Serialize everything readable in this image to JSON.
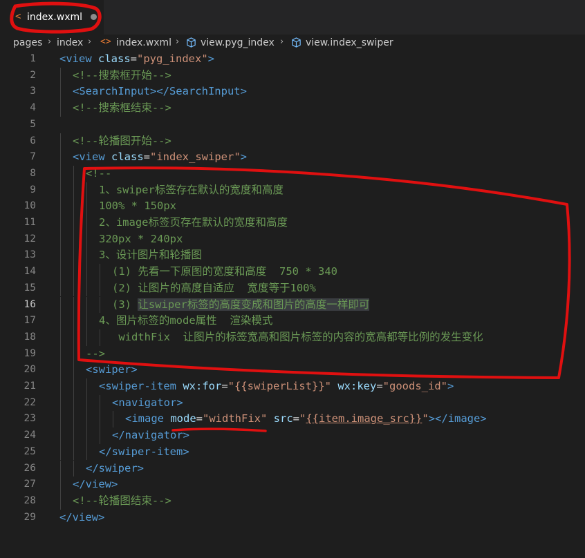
{
  "tab": {
    "icon": "xml-file-icon",
    "label": "index.wxml"
  },
  "breadcrumb": {
    "items": [
      "pages",
      "index",
      "index.wxml",
      "view.pyg_index",
      "view.index_swiper"
    ]
  },
  "editor": {
    "active_line": 16,
    "lines": [
      {
        "n": "1",
        "indent": 0,
        "tokens": [
          [
            "t",
            "<view "
          ],
          [
            "a",
            "class"
          ],
          [
            "w",
            "="
          ],
          [
            "s",
            "\"pyg_index\""
          ],
          [
            "t",
            ">"
          ]
        ]
      },
      {
        "n": "2",
        "indent": 1,
        "tokens": [
          [
            "c",
            "<!--搜索框开始-->"
          ]
        ]
      },
      {
        "n": "3",
        "indent": 1,
        "tokens": [
          [
            "t",
            "<SearchInput></SearchInput>"
          ]
        ]
      },
      {
        "n": "4",
        "indent": 1,
        "tokens": [
          [
            "c",
            "<!--搜索框结束-->"
          ]
        ]
      },
      {
        "n": "5",
        "indent": 0,
        "tokens": []
      },
      {
        "n": "6",
        "indent": 1,
        "tokens": [
          [
            "c",
            "<!--轮播图开始-->"
          ]
        ]
      },
      {
        "n": "7",
        "indent": 1,
        "tokens": [
          [
            "t",
            "<view "
          ],
          [
            "a",
            "class"
          ],
          [
            "w",
            "="
          ],
          [
            "s",
            "\"index_swiper\""
          ],
          [
            "t",
            ">"
          ]
        ]
      },
      {
        "n": "8",
        "indent": 2,
        "tokens": [
          [
            "c",
            "<!--"
          ]
        ]
      },
      {
        "n": "9",
        "indent": 3,
        "tokens": [
          [
            "c",
            "1、swiper标签存在默认的宽度和高度"
          ]
        ]
      },
      {
        "n": "10",
        "indent": 3,
        "tokens": [
          [
            "c",
            "100% * 150px"
          ]
        ]
      },
      {
        "n": "11",
        "indent": 3,
        "tokens": [
          [
            "c",
            "2、image标签页存在默认的宽度和高度"
          ]
        ]
      },
      {
        "n": "12",
        "indent": 3,
        "tokens": [
          [
            "c",
            "320px * 240px"
          ]
        ]
      },
      {
        "n": "13",
        "indent": 3,
        "tokens": [
          [
            "c",
            "3、设计图片和轮播图"
          ]
        ]
      },
      {
        "n": "14",
        "indent": 4,
        "tokens": [
          [
            "c",
            "(1) 先看一下原图的宽度和高度  750 * 340"
          ]
        ]
      },
      {
        "n": "15",
        "indent": 4,
        "tokens": [
          [
            "c",
            "(2) 让图片的高度自适应  宽度等于100%"
          ]
        ]
      },
      {
        "n": "16",
        "indent": 4,
        "tokens": [
          [
            "c",
            "(3) "
          ],
          [
            "chl",
            "让swiper标签的高度变成和图片的高度一样即可"
          ]
        ]
      },
      {
        "n": "17",
        "indent": 3,
        "tokens": [
          [
            "c",
            "4、图片标签的mode属性  渲染模式"
          ]
        ]
      },
      {
        "n": "18",
        "indent": 4,
        "tokens": [
          [
            "c",
            " widthFix  让图片的标签宽高和图片标签的内容的宽高都等比例的发生变化"
          ]
        ]
      },
      {
        "n": "19",
        "indent": 2,
        "tokens": [
          [
            "c",
            "-->"
          ]
        ]
      },
      {
        "n": "20",
        "indent": 2,
        "tokens": [
          [
            "t",
            "<swiper>"
          ]
        ]
      },
      {
        "n": "21",
        "indent": 3,
        "tokens": [
          [
            "t",
            "<swiper-item "
          ],
          [
            "a",
            "wx:for"
          ],
          [
            "w",
            "="
          ],
          [
            "s",
            "\"{{swiperList}}\""
          ],
          [
            "w",
            " "
          ],
          [
            "a",
            "wx:key"
          ],
          [
            "w",
            "="
          ],
          [
            "s",
            "\"goods_id\""
          ],
          [
            "t",
            ">"
          ]
        ]
      },
      {
        "n": "22",
        "indent": 4,
        "tokens": [
          [
            "t",
            "<navigator>"
          ]
        ]
      },
      {
        "n": "23",
        "indent": 5,
        "tokens": [
          [
            "t",
            "<image "
          ],
          [
            "a",
            "mode"
          ],
          [
            "w",
            "="
          ],
          [
            "s",
            "\"widthFix\""
          ],
          [
            "w",
            " "
          ],
          [
            "a",
            "src"
          ],
          [
            "w",
            "="
          ],
          [
            "s",
            "\""
          ],
          [
            "sul",
            "{{item.image_src}}"
          ],
          [
            "s",
            "\""
          ],
          [
            "t",
            "></image>"
          ]
        ]
      },
      {
        "n": "24",
        "indent": 4,
        "tokens": [
          [
            "t",
            "</navigator>"
          ]
        ]
      },
      {
        "n": "25",
        "indent": 3,
        "tokens": [
          [
            "t",
            "</swiper-item>"
          ]
        ]
      },
      {
        "n": "26",
        "indent": 2,
        "tokens": [
          [
            "t",
            "</swiper>"
          ]
        ]
      },
      {
        "n": "27",
        "indent": 1,
        "tokens": [
          [
            "t",
            "</view>"
          ]
        ]
      },
      {
        "n": "28",
        "indent": 1,
        "tokens": [
          [
            "c",
            "<!--轮播图结束-->"
          ]
        ]
      },
      {
        "n": "29",
        "indent": 0,
        "tokens": [
          [
            "t",
            "</view>"
          ]
        ]
      }
    ]
  },
  "colors": {
    "background": "#1e1e1e",
    "tag": "#569cd6",
    "attribute": "#9cdcfe",
    "string": "#ce9178",
    "comment": "#6a9955",
    "annotation": "#e01010"
  }
}
